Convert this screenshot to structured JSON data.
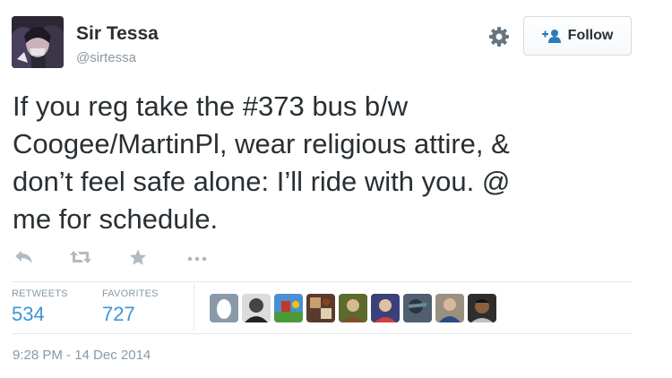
{
  "author": {
    "display_name": "Sir Tessa",
    "handle": "@sirtessa",
    "avatar_icon": "user-avatar"
  },
  "header": {
    "settings_icon": "gear-icon",
    "follow_label": "Follow",
    "follow_icon": "add-user-icon"
  },
  "tweet": {
    "text": "If you reg take the #373 bus b/w\nCoogee/MartinPl, wear religious attire, &\ndon’t feel safe alone: I’ll ride with you. @\nme for schedule."
  },
  "actions": [
    "reply-icon",
    "retweet-icon",
    "favorite-icon",
    "more-icon"
  ],
  "stats": {
    "retweets_label": "RETWEETS",
    "retweets_count": "534",
    "favorites_label": "FAVORITES",
    "favorites_count": "727"
  },
  "favoriters": [
    {
      "icon": "default-egg-avatar",
      "color": "#8a9aa8"
    },
    {
      "icon": "user-avatar",
      "color": "#555555"
    },
    {
      "icon": "user-avatar",
      "color": "#2f7ac4"
    },
    {
      "icon": "user-avatar",
      "color": "#7a3f2a"
    },
    {
      "icon": "user-avatar",
      "color": "#6e7a3a"
    },
    {
      "icon": "user-avatar",
      "color": "#4a4f8a"
    },
    {
      "icon": "user-avatar",
      "color": "#556677"
    },
    {
      "icon": "user-avatar",
      "color": "#8a7a6a"
    },
    {
      "icon": "user-avatar",
      "color": "#3a3a3a"
    }
  ],
  "timestamp": "9:28 PM - 14 Dec 2014",
  "colors": {
    "link": "#3b94d9",
    "muted": "#8899a6",
    "text": "#292f33",
    "action_icon": "#b1bbc3"
  }
}
